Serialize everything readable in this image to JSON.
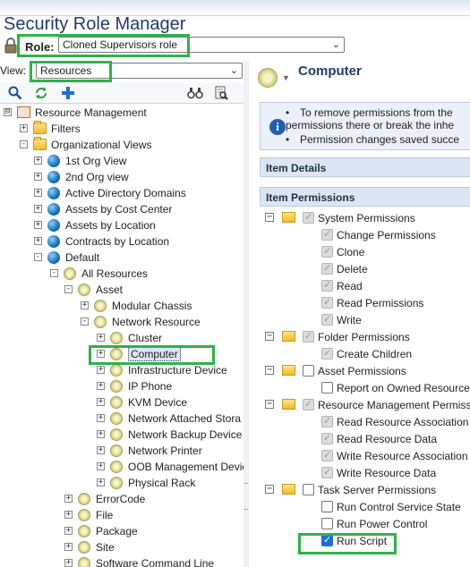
{
  "app": {
    "title": "Security Role Manager"
  },
  "role": {
    "label": "Role:",
    "value": "Cloned Supervisors role"
  },
  "view": {
    "label": "View:",
    "value": "Resources"
  },
  "toolbar": {
    "icons": [
      "search-icon",
      "refresh-icon",
      "add-icon",
      "binoculars-icon",
      "find-report-icon"
    ]
  },
  "tree": [
    {
      "label": "Resource Management",
      "icon": "resource-management-icon",
      "exp": "⊟"
    },
    {
      "label": "Filters",
      "icon": "folder-icon",
      "exp": "+"
    },
    {
      "label": "Organizational Views",
      "icon": "folder-icon",
      "exp": "-"
    },
    {
      "label": "1st Org View",
      "icon": "globe-icon",
      "exp": "+"
    },
    {
      "label": "2nd Org view",
      "icon": "globe-icon",
      "exp": "+"
    },
    {
      "label": "Active Directory Domains",
      "icon": "globe-icon",
      "exp": "+"
    },
    {
      "label": "Assets by Cost Center",
      "icon": "globe-icon",
      "exp": "+"
    },
    {
      "label": "Assets by Location",
      "icon": "globe-icon",
      "exp": "+"
    },
    {
      "label": "Contracts by Location",
      "icon": "globe-icon",
      "exp": "+"
    },
    {
      "label": "Default",
      "icon": "globe-icon",
      "exp": "-"
    },
    {
      "label": "All Resources",
      "icon": "resource-ring-icon",
      "exp": "-"
    },
    {
      "label": "Asset",
      "icon": "resource-ring-icon",
      "exp": "-"
    },
    {
      "label": "Modular Chassis",
      "icon": "resource-ring-icon",
      "exp": "+"
    },
    {
      "label": "Network Resource",
      "icon": "resource-ring-icon",
      "exp": "-"
    },
    {
      "label": "Cluster",
      "icon": "resource-ring-icon",
      "exp": "+"
    },
    {
      "label": "Computer",
      "icon": "resource-ring-icon",
      "exp": "+",
      "selected": true
    },
    {
      "label": "Infrastructure Device",
      "icon": "resource-ring-icon",
      "exp": "+"
    },
    {
      "label": "IP Phone",
      "icon": "resource-ring-icon",
      "exp": "+"
    },
    {
      "label": "KVM Device",
      "icon": "resource-ring-icon",
      "exp": "+"
    },
    {
      "label": "Network Attached Stora",
      "icon": "resource-ring-icon",
      "exp": "+"
    },
    {
      "label": "Network Backup Device",
      "icon": "resource-ring-icon",
      "exp": "+"
    },
    {
      "label": "Network Printer",
      "icon": "resource-ring-icon",
      "exp": "+"
    },
    {
      "label": "OOB Management Devic",
      "icon": "resource-ring-icon",
      "exp": "+"
    },
    {
      "label": "Physical Rack",
      "icon": "resource-ring-icon",
      "exp": "+"
    },
    {
      "label": "ErrorCode",
      "icon": "resource-ring-icon",
      "exp": "+"
    },
    {
      "label": "File",
      "icon": "resource-ring-icon",
      "exp": "+"
    },
    {
      "label": "Package",
      "icon": "resource-ring-icon",
      "exp": "+"
    },
    {
      "label": "Site",
      "icon": "resource-ring-icon",
      "exp": "+"
    },
    {
      "label": "Software Command Line",
      "icon": "resource-ring-icon",
      "exp": "+"
    }
  ],
  "details": {
    "title": "Computer",
    "info": [
      "To remove permissions from the",
      "permissions there or break the inhe",
      "Permission changes saved succe"
    ],
    "item_details_header": "Item Details",
    "item_permissions_header": "Item Permissions"
  },
  "permissions": [
    {
      "label": "System Permissions",
      "state": "disabled",
      "group": true
    },
    {
      "label": "Change Permissions",
      "state": "disabled"
    },
    {
      "label": "Clone",
      "state": "disabled"
    },
    {
      "label": "Delete",
      "state": "disabled"
    },
    {
      "label": "Read",
      "state": "disabled"
    },
    {
      "label": "Read Permissions",
      "state": "disabled"
    },
    {
      "label": "Write",
      "state": "disabled"
    },
    {
      "label": "Folder Permissions",
      "state": "disabled",
      "group": true
    },
    {
      "label": "Create Children",
      "state": "disabled"
    },
    {
      "label": "Asset Permissions",
      "state": "unchecked",
      "group": true
    },
    {
      "label": "Report on Owned Resource",
      "state": "unchecked"
    },
    {
      "label": "Resource Management Permiss",
      "state": "disabled",
      "group": true
    },
    {
      "label": "Read Resource Association",
      "state": "disabled"
    },
    {
      "label": "Read Resource Data",
      "state": "disabled"
    },
    {
      "label": "Write Resource Association",
      "state": "disabled"
    },
    {
      "label": "Write Resource Data",
      "state": "disabled"
    },
    {
      "label": "Task Server Permissions",
      "state": "unchecked",
      "group": true
    },
    {
      "label": "Run Control Service State",
      "state": "unchecked"
    },
    {
      "label": "Run Power Control",
      "state": "unchecked"
    },
    {
      "label": "Run Script",
      "state": "checked"
    }
  ],
  "colors": {
    "highlight": "#2fb24a",
    "title": "#1f3c6b",
    "header_bg": "#dce6f2"
  }
}
